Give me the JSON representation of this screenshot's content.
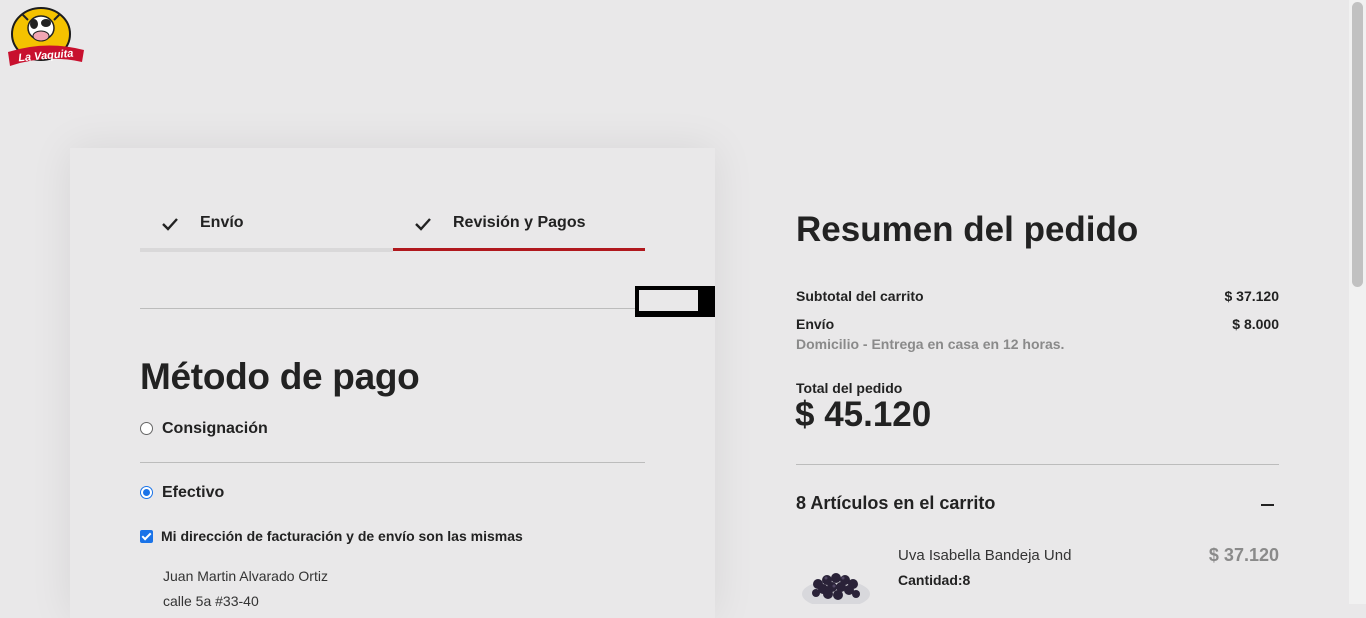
{
  "brand": {
    "logo_text": "La Vaquita"
  },
  "checkout_steps": [
    {
      "label": "Envío",
      "icon": "check-icon",
      "state": "complete"
    },
    {
      "label": "Revisión y Pagos",
      "icon": "check-icon",
      "state": "active"
    }
  ],
  "payment": {
    "title": "Método de pago",
    "options": [
      {
        "label": "Consignación",
        "selected": false
      },
      {
        "label": "Efectivo",
        "selected": true
      }
    ],
    "same_address_label": "Mi dirección de facturación y de envío son las mismas",
    "same_address_checked": true,
    "address_lines": [
      "Juan Martin Alvarado Ortiz",
      "calle 5a #33-40"
    ]
  },
  "summary": {
    "title": "Resumen del pedido",
    "subtotal_label": "Subtotal del carrito",
    "subtotal_value": "$ 37.120",
    "shipping_label": "Envío",
    "shipping_value": "$ 8.000",
    "shipping_method": "Domicilio - Entrega en casa en 12 horas.",
    "total_label": "Total del pedido",
    "total_value": "$ 45.120",
    "items_title": "8 Artículos en el carrito",
    "items": [
      {
        "name": "Uva Isabella Bandeja Und",
        "quantity_text": "Cantidad:8",
        "price": "$ 37.120"
      }
    ]
  },
  "colors": {
    "accent": "#b0181d",
    "background": "#e9e8e9",
    "radio_checked": "#1a73e8"
  }
}
